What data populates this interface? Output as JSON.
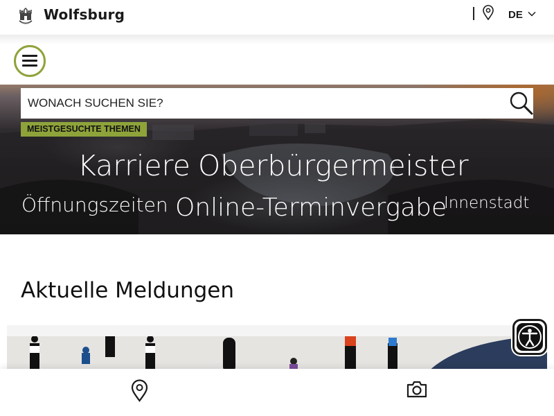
{
  "header": {
    "brand": "Wolfsburg",
    "language": "DE",
    "icons": [
      "city-crest-icon",
      "location-pin-icon",
      "chevron-down-icon"
    ]
  },
  "menu": {
    "icon": "hamburger-menu-icon"
  },
  "hero": {
    "search_placeholder": "WONACH SUCHEN SIE?",
    "search_icon": "search-icon",
    "topics_label": "MEISTGESUCHTE THEMEN",
    "topics": [
      "Karriere",
      "Oberbürgermeister",
      "Öffnungszeiten",
      "Online-Terminvergabe",
      "Innenstadt"
    ]
  },
  "news": {
    "title": "Aktuelle Meldungen"
  },
  "accessibility": {
    "icon": "accessibility-person-icon"
  },
  "bottom_nav": {
    "icons": [
      "location-pin-icon",
      "camera-icon"
    ]
  },
  "colors": {
    "accent_green": "#8ea33a",
    "text_dark": "#111111"
  }
}
